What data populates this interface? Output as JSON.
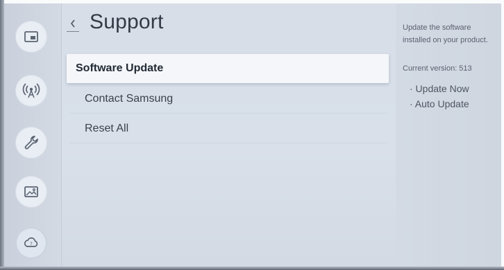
{
  "icons": {
    "back": "chevron-left-icon",
    "rail": [
      "picture-in-picture-icon",
      "broadcast-antenna-icon",
      "wrench-icon",
      "image-icon",
      "support-cloud-icon"
    ]
  },
  "header": {
    "title": "Support"
  },
  "menu": {
    "items": [
      {
        "label": "Software Update"
      },
      {
        "label": "Contact Samsung"
      },
      {
        "label": "Reset All"
      }
    ]
  },
  "info": {
    "description": "Update the software installed on your product.",
    "version_label": "Current version: 513",
    "options": [
      "· Update Now",
      "· Auto Update"
    ]
  },
  "colors": {
    "accent_selected": "#f4f6f9",
    "text_primary": "#323a46"
  }
}
